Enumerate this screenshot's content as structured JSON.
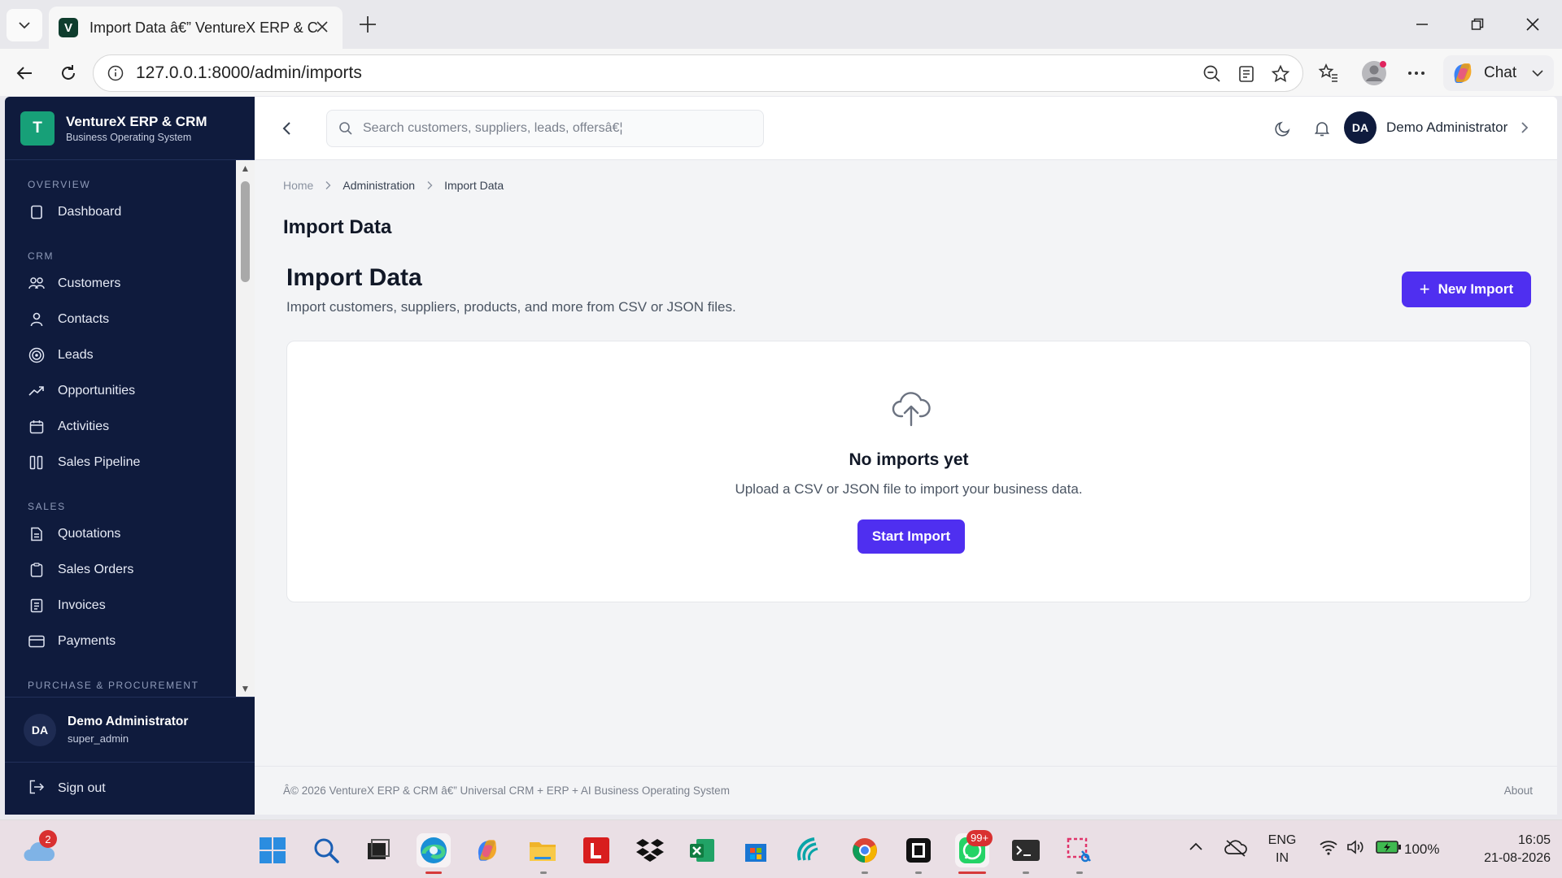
{
  "browser": {
    "tab_title": "Import Data â€” VentureX ERP & C",
    "url": "127.0.0.1:8000/admin/imports",
    "chat_label": "Chat"
  },
  "brand": {
    "logo_letter": "T",
    "name": "VentureX ERP & CRM",
    "subtitle": "Business Operating System"
  },
  "sidebar": {
    "sections": [
      {
        "title": "OVERVIEW",
        "items": [
          {
            "label": "Dashboard",
            "icon": "square-icon"
          }
        ]
      },
      {
        "title": "CRM",
        "items": [
          {
            "label": "Customers",
            "icon": "users-icon"
          },
          {
            "label": "Contacts",
            "icon": "user-icon"
          },
          {
            "label": "Leads",
            "icon": "target-icon"
          },
          {
            "label": "Opportunities",
            "icon": "trend-up-icon"
          },
          {
            "label": "Activities",
            "icon": "calendar-icon"
          },
          {
            "label": "Sales Pipeline",
            "icon": "columns-icon"
          }
        ]
      },
      {
        "title": "SALES",
        "items": [
          {
            "label": "Quotations",
            "icon": "file-text-icon"
          },
          {
            "label": "Sales Orders",
            "icon": "clipboard-icon"
          },
          {
            "label": "Invoices",
            "icon": "receipt-icon"
          },
          {
            "label": "Payments",
            "icon": "credit-card-icon"
          }
        ]
      },
      {
        "title": "PURCHASE & PROCUREMENT",
        "items": []
      }
    ],
    "user": {
      "initials": "DA",
      "name": "Demo Administrator",
      "role": "super_admin"
    },
    "signout_label": "Sign out"
  },
  "topbar": {
    "search_placeholder": "Search customers, suppliers, leads, offersâ€¦",
    "user_initials": "DA",
    "user_name": "Demo Administrator"
  },
  "breadcrumb": [
    "Home",
    "Administration",
    "Import Data"
  ],
  "page": {
    "header_title": "Import Data",
    "title": "Import Data",
    "subtitle": "Import customers, suppliers, products, and more from CSV or JSON files.",
    "new_import_label": "New Import"
  },
  "empty_state": {
    "title": "No imports yet",
    "text": "Upload a CSV or JSON file to import your business data.",
    "button_label": "Start Import"
  },
  "footer": {
    "text": "Â© 2026 VentureX ERP & CRM â€” Universal CRM + ERP + AI Business Operating System",
    "about": "About"
  },
  "taskbar": {
    "weather_badge": "2",
    "whatsapp_badge": "99+",
    "lang_line1": "ENG",
    "lang_line2": "IN",
    "battery": "100%",
    "time": "16:05",
    "date": "21-08-2026"
  },
  "colors": {
    "sidebar_bg": "#0f1b3d",
    "primary": "#4f2ff0",
    "brand_logo": "#17a078"
  }
}
